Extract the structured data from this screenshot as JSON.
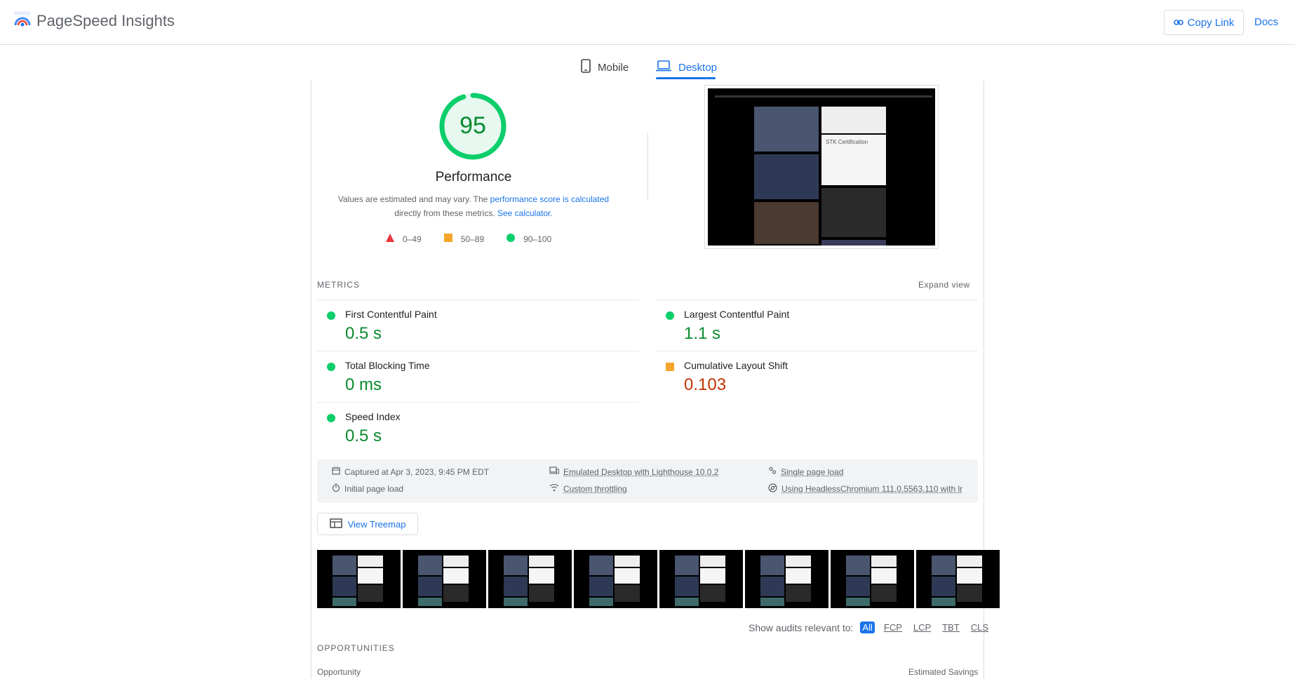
{
  "header": {
    "title": "PageSpeed Insights",
    "copy_link": "Copy Link",
    "docs": "Docs"
  },
  "tabs": [
    {
      "label": "Mobile",
      "icon": "phone-icon",
      "active": false
    },
    {
      "label": "Desktop",
      "icon": "laptop-icon",
      "active": true
    }
  ],
  "performance": {
    "score": "95",
    "score_fraction": 0.95,
    "title": "Performance",
    "note_1": "Values are estimated and may vary. The ",
    "note_link_1": "performance score is calculated",
    "note_2": "directly from these metrics. ",
    "note_link_2": "See calculator.",
    "legend": [
      {
        "label": "0–49",
        "shape": "triangle",
        "color": "#e8343a"
      },
      {
        "label": "50–89",
        "shape": "square",
        "color": "#f4a62a"
      },
      {
        "label": "90–100",
        "shape": "circle",
        "color": "#0cce6b"
      }
    ]
  },
  "preview": {
    "cert_text": "STK Certification"
  },
  "metrics": {
    "heading": "METRICS",
    "expand": "Expand view",
    "left": [
      {
        "name": "First Contentful Paint",
        "value": "0.5 s",
        "rating": "good"
      },
      {
        "name": "Total Blocking Time",
        "value": "0 ms",
        "rating": "good"
      },
      {
        "name": "Speed Index",
        "value": "0.5 s",
        "rating": "good"
      }
    ],
    "right": [
      {
        "name": "Largest Contentful Paint",
        "value": "1.1 s",
        "rating": "good"
      },
      {
        "name": "Cumulative Layout Shift",
        "value": "0.103",
        "rating": "average"
      }
    ]
  },
  "run_info": {
    "captured": "Captured at Apr 3, 2023, 9:45 PM EDT",
    "initial": "Initial page load",
    "emulated": "Emulated Desktop with Lighthouse 10.0.2",
    "throttling": "Custom throttling",
    "single": "Single page load",
    "browser": "Using HeadlessChromium 111.0.5563.110 with lr"
  },
  "treemap": "View Treemap",
  "filter": {
    "label": "Show audits relevant to:",
    "chips": [
      "All",
      "FCP",
      "LCP",
      "TBT",
      "CLS"
    ]
  },
  "opportunities": {
    "heading": "OPPORTUNITIES",
    "col_left": "Opportunity",
    "col_right": "Estimated Savings"
  },
  "colors": {
    "accent": "#1a73e8",
    "good": "#0cce6b",
    "good_text": "#0a8a2f",
    "average": "#f4a62a",
    "average_text": "#c33300"
  }
}
